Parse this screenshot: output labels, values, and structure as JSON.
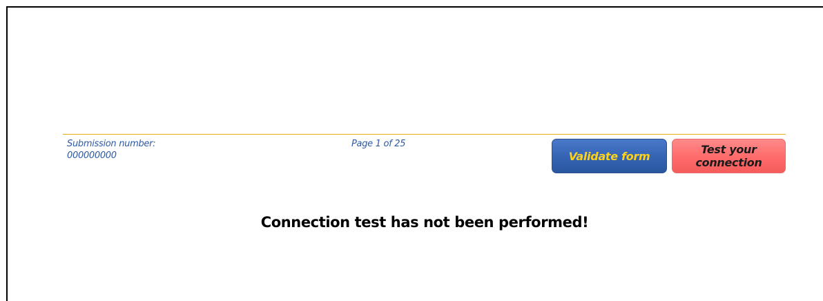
{
  "footer": {
    "submission_label": "Submission number:",
    "submission_value": "000000000",
    "page_indicator": "Page 1 of 25"
  },
  "buttons": {
    "validate_label": "Validate form",
    "test_label": "Test your connection"
  },
  "status": {
    "message": "Connection test has not been performed!"
  },
  "colors": {
    "rule": "#e8b10a",
    "footer_text": "#2c5aa6",
    "validate_bg": "#3463b3",
    "validate_text": "#ffd21a",
    "test_bg": "#ff6a6a",
    "test_text": "#1a1a1a"
  }
}
